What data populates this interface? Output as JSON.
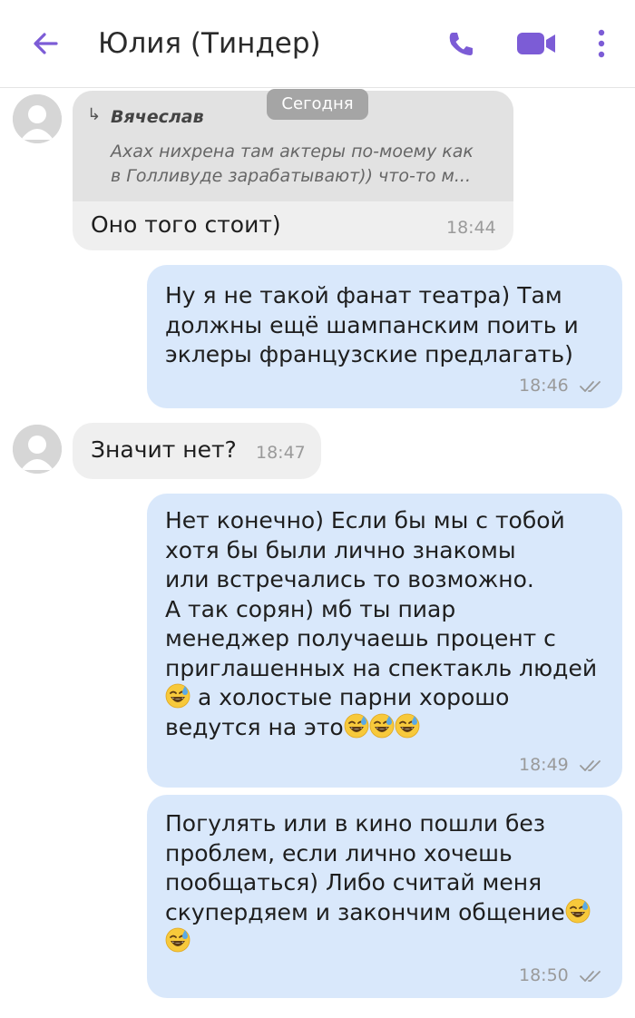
{
  "header": {
    "title": "Юлия (Тиндер)"
  },
  "date_separator": "Сегодня",
  "messages": [
    {
      "direction": "incoming",
      "quote_author": "Вячеслав",
      "quote_lines": [
        "Ахах нихрена там актеры по-моему как",
        "в Голливуде зарабатывают)) что-то м..."
      ],
      "lines": [
        "Оно того стоит)"
      ],
      "time": "18:44"
    },
    {
      "direction": "outgoing",
      "lines": [
        "Ну я не такой фанат театра) Там",
        "должны ещё шампанским поить и",
        "эклеры французские предлагать)"
      ],
      "time": "18:46"
    },
    {
      "direction": "incoming",
      "lines": [
        "Значит нет?"
      ],
      "time": "18:47"
    },
    {
      "direction": "outgoing",
      "lines": [
        "Нет конечно) Если бы мы с тобой",
        "хотя бы были лично знакомы",
        "или встречались то возможно.",
        "А так сорян) мб ты пиар",
        "менеджер получаешь процент с",
        "приглашенных на спектакль людей",
        "а холостые парни хорошо",
        "ведутся на это"
      ],
      "time": "18:49"
    },
    {
      "direction": "outgoing",
      "lines": [
        "Погулять или в кино пошли без",
        "проблем, если лично хочешь",
        "пообщаться) Либо считай меня",
        "скупердяем и закончим общение"
      ],
      "time": "18:50"
    }
  ],
  "emoji_name": "grinning-sweat-emoji",
  "colors": {
    "accent": "#7c5cd6",
    "incoming_bubble": "#efefef",
    "outgoing_bubble": "#d9e8fb",
    "quote_bg": "#e2e2e2"
  }
}
